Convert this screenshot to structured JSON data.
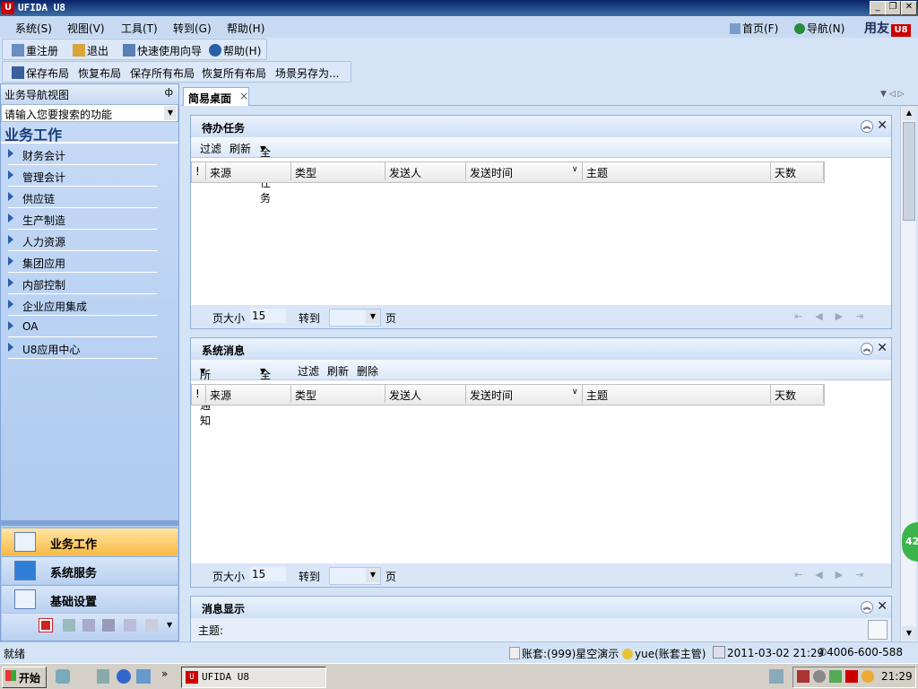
{
  "window": {
    "title": "UFIDA U8",
    "min": "_",
    "restore": "❐",
    "close": "✕"
  },
  "menu": {
    "items": [
      "系统(S)",
      "视图(V)",
      "工具(T)",
      "转到(G)",
      "帮助(H)"
    ],
    "right": {
      "home": "首页(F)",
      "nav": "导航(N)",
      "brand": "用友"
    }
  },
  "toolbar1": {
    "reregister": "重注册",
    "exit": "退出",
    "wizard": "快速使用向导",
    "help": "帮助(H)"
  },
  "toolbar2": {
    "save_layout": "保存布局",
    "restore_layout": "恢复布局",
    "save_all": "保存所有布局",
    "restore_all": "恢复所有布局",
    "save_as": "场景另存为..."
  },
  "left": {
    "header": "业务导航视图",
    "search_placeholder": "请输入您要搜索的功能",
    "section": "业务工作",
    "items": [
      "财务会计",
      "管理会计",
      "供应链",
      "生产制造",
      "人力资源",
      "集团应用",
      "内部控制",
      "企业应用集成",
      "OA",
      "U8应用中心"
    ],
    "bottom": [
      "业务工作",
      "系统服务",
      "基础设置"
    ]
  },
  "tabs": [
    {
      "label": "简易桌面"
    }
  ],
  "todo": {
    "title": "待办任务",
    "toolbar": [
      "过滤",
      "刷新",
      "全部任务"
    ],
    "columns": [
      "!",
      "来源",
      "类型",
      "发送人",
      "发送时间",
      "主题",
      "天数"
    ],
    "page_size_label": "页大小",
    "page_size": "15",
    "goto_label": "转到",
    "page_label": "页"
  },
  "sysmsg": {
    "title": "系统消息",
    "toolbar": [
      "所有通知",
      "全部",
      "过滤",
      "刷新",
      "删除"
    ],
    "columns": [
      "!",
      "来源",
      "类型",
      "发送人",
      "发送时间",
      "主题",
      "天数"
    ],
    "page_size_label": "页大小",
    "page_size": "15",
    "goto_label": "转到",
    "page_label": "页"
  },
  "msgshow": {
    "title": "消息显示",
    "subject_label": "主题:"
  },
  "status": {
    "ready": "就绪",
    "account": "账套:(999)星空演示",
    "user": "yue(账套主管)",
    "datetime": "2011-03-02 21:29",
    "phone": "4006-600-588"
  },
  "taskbar": {
    "start": "开始",
    "task": "UFIDA U8",
    "clock": "21:29",
    "more": "»"
  },
  "side_badge": "42"
}
